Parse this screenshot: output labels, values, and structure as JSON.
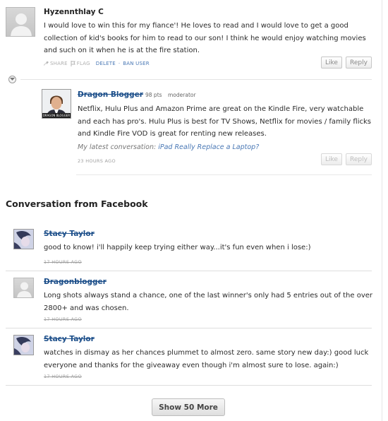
{
  "comment1": {
    "author": "Hyzennthlay C",
    "text": "I would love to win this for my fiance'! He loves to read and I would love to get a good collection of kid's books for him to read to our son! I think he would enjoy watching movies and such on it when he is at the fire station.",
    "actions": {
      "share": "SHARE",
      "flag": "FLAG",
      "delete": "DELETE",
      "separator": "·",
      "ban": "BAN USER"
    },
    "like_label": "Like",
    "reply_label": "Reply"
  },
  "reply": {
    "author": "Dragon Blogger",
    "points": "98 pts",
    "role": "moderator",
    "avatar_caption": "DRAGON BLOGGER",
    "text": "Netflix, Hulu Plus and Amazon Prime are great on the Kindle Fire, very watchable and each has pro's. Hulu Plus is best for TV Shows, Netflix for movies / family flicks and Kindle Fire VOD is great for renting new releases.",
    "latest_prefix": "My latest conversation:",
    "latest_link": "iPad Really Replace a Laptop?",
    "time": "23 HOURS AGO",
    "like_label": "Like",
    "reply_label": "Reply"
  },
  "facebook": {
    "heading": "Conversation from Facebook",
    "comments": [
      {
        "author": "Stacy Taylor",
        "text": "good to know! i'll happily keep trying either way...it's fun even when i lose:)",
        "time": "17 HOURS AGO"
      },
      {
        "author": "Dragonblogger",
        "text": "Long shots always stand a chance, one of the last winner's only had 5 entries out of the over 2800+ and was chosen.",
        "time": "17 HOURS AGO"
      },
      {
        "author": "Stacy Taylor",
        "text": "watches in dismay as her chances plummet to almost zero. same story new day:) good luck everyone and thanks for the giveaway even though i'm almost sure to lose. again:)",
        "time": "17 HOURS AGO"
      }
    ],
    "more_label": "Show 50 More"
  },
  "colors": {
    "link": "#1d4f8a",
    "action_blue": "#4a78b5",
    "meta_gray": "#a0a0a0"
  }
}
